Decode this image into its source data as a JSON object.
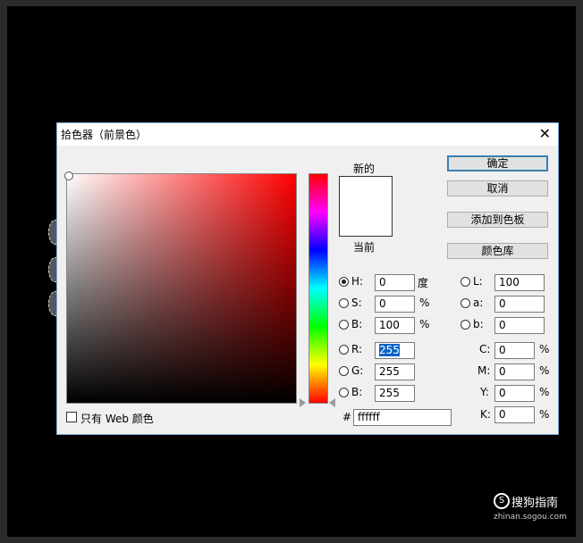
{
  "dialog": {
    "title": "拾色器（前景色）",
    "close_glyph": "✕"
  },
  "swatch": {
    "new_label": "新的",
    "current_label": "当前",
    "new_color": "#ffffff",
    "current_color": "#ffffff"
  },
  "buttons": {
    "ok": "确定",
    "cancel": "取消",
    "add_to_swatches": "添加到色板",
    "color_libraries": "颜色库"
  },
  "hsb": {
    "h": {
      "label": "H:",
      "value": "0",
      "unit": "度",
      "checked": true
    },
    "s": {
      "label": "S:",
      "value": "0",
      "unit": "%"
    },
    "b": {
      "label": "B:",
      "value": "100",
      "unit": "%"
    }
  },
  "rgb": {
    "r": {
      "label": "R:",
      "value": "255"
    },
    "g": {
      "label": "G:",
      "value": "255"
    },
    "b": {
      "label": "B:",
      "value": "255"
    }
  },
  "lab": {
    "l": {
      "label": "L:",
      "value": "100"
    },
    "a": {
      "label": "a:",
      "value": "0"
    },
    "b": {
      "label": "b:",
      "value": "0"
    }
  },
  "cmyk": {
    "c": {
      "label": "C:",
      "value": "0",
      "unit": "%"
    },
    "m": {
      "label": "M:",
      "value": "0",
      "unit": "%"
    },
    "y": {
      "label": "Y:",
      "value": "0",
      "unit": "%"
    },
    "k": {
      "label": "K:",
      "value": "0",
      "unit": "%"
    }
  },
  "hex": {
    "label": "#",
    "value": "ffffff"
  },
  "web_only": {
    "label": "只有 Web 颜色"
  },
  "watermark": {
    "glyph": "S",
    "text": "搜狗指南",
    "url": "zhinan.sogou.com"
  },
  "colors": {
    "accent": "#3c7fb1",
    "selection": "#0a64c8",
    "hue_selected": "#ff0000"
  }
}
